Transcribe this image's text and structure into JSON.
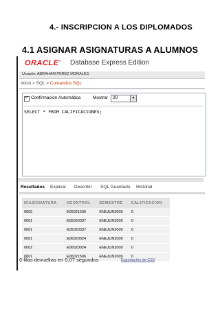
{
  "headings": {
    "section": "4.- INSCRIPCION A LOS DIPLOMADOS",
    "subsection": "4.1 ASIGNAR ASIGNATURAS A ALUMNOS"
  },
  "app": {
    "logo": "ORACLE",
    "logo_mark": "®",
    "product": "Database Express Edition",
    "user": "Usuario: ABRAHAM PEREZ MORALES"
  },
  "breadcrumb": {
    "inicio": "Inicio",
    "sep1": " > ",
    "sql": "SQL",
    "sep2": " > ",
    "current": "Comandos SQL"
  },
  "toolbar": {
    "autocommit_label": "Confirmación Automática",
    "autocommit_checked": true,
    "check_glyph": "✓",
    "show_label": "Mostrar",
    "show_value": "20",
    "dropdown_glyph": "▼"
  },
  "editor": {
    "sql": "SELECT * FROM CALIFICACIONES;"
  },
  "tabs": [
    "Resultados",
    "Explicar",
    "Describir",
    "SQL Guardado",
    "Historial"
  ],
  "results": {
    "columns": [
      "IDASIGNATURA",
      "NCONTROL",
      "SEMESTRE",
      "CALIFICACION"
    ],
    "rows": [
      [
        "0002",
        "E06021506",
        "ENEJUN2009",
        "0"
      ],
      [
        "0001",
        "E05020337",
        "ENEJUN2009",
        "0"
      ],
      [
        "0001",
        "E05020337",
        "ENEJUN2009",
        "0"
      ],
      [
        "0001",
        "E06020024",
        "ENEJUN2009",
        "0"
      ],
      [
        "0002",
        "E06020024",
        "ENEJUN2009",
        "0"
      ],
      [
        "0001",
        "E06021506",
        "ENEJUN2009",
        "0"
      ]
    ],
    "status": "6 filas devueltas en 0,07 segundos",
    "export_link": "Exportación de CSV"
  }
}
